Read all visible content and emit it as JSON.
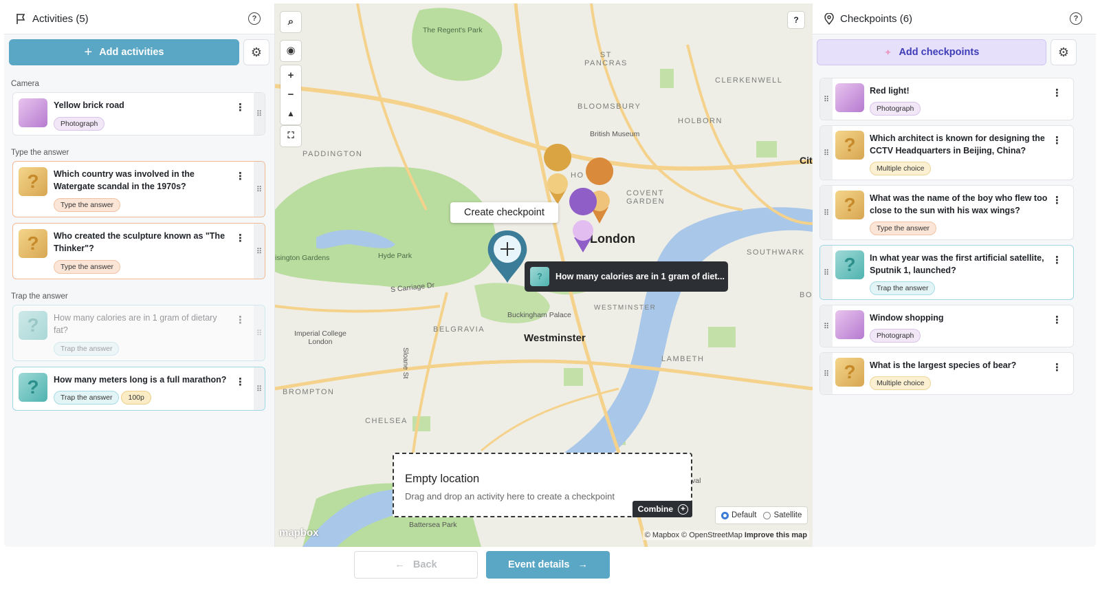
{
  "left_panel": {
    "title": "Activities (5)",
    "add_label": "Add activities",
    "sections": {
      "camera": "Camera",
      "type": "Type the answer",
      "trap": "Trap the answer"
    },
    "cards": [
      {
        "title": "Yellow brick road",
        "badges": [
          "Photograph"
        ]
      },
      {
        "title": "Which country was involved in the Watergate scandal in the 1970s?",
        "badges": [
          "Type the answer"
        ]
      },
      {
        "title": "Who created the sculpture known as \"The Thinker\"?",
        "badges": [
          "Type the answer"
        ]
      },
      {
        "title": "How many calories are in 1 gram of dietary fat?",
        "badges": [
          "Trap the answer"
        ]
      },
      {
        "title": "How many meters long is a full marathon?",
        "badges": [
          "Trap the answer",
          "100p"
        ]
      }
    ]
  },
  "map": {
    "create_tooltip": "Create checkpoint",
    "hover_tooltip": "How many calories are in 1 gram of diet...",
    "labels": {
      "regents_park": "The Regent's Park",
      "st_pancras": "ST\nPANCRAS",
      "clerkenwell": "CLERKENWELL",
      "bloomsbury": "BLOOMSBURY",
      "holborn": "HOLBORN",
      "british_museum": "British Museum",
      "paddington": "PADDINGTON",
      "city": "Cit",
      "covent_garden": "COVENT\nGARDEN",
      "soho": "HO",
      "london": "London",
      "southwark": "SOUTHWARK",
      "hyde_park": "Hyde Park",
      "kensington_gardens": "isington Gardens",
      "s_carriage": "S Carriage Dr",
      "westminster_upper": "WESTMINSTER",
      "bor": "BOR",
      "buckingham": "Buckingham Palace",
      "belgravia": "BELGRAVIA",
      "imperial": "Imperial College\nLondon",
      "westminster": "Westminster",
      "sloane": "Sloane St",
      "lambeth": "LAMBETH",
      "brompton": "BROMPTON",
      "chelsea": "CHELSEA",
      "battersea": "Battersea Park",
      "val": "val"
    },
    "empty_title": "Empty location",
    "empty_subtitle": "Drag and drop an activity here to create a checkpoint",
    "combine_label": "Combine",
    "style_default": "Default",
    "style_satellite": "Satellite",
    "attribution": "© Mapbox © OpenStreetMap",
    "improve": "Improve this map",
    "logo": "mapbox"
  },
  "right_panel": {
    "title": "Checkpoints (6)",
    "add_label": "Add checkpoints",
    "cards": [
      {
        "title": "Red light!",
        "badges": [
          "Photograph"
        ]
      },
      {
        "title": "Which architect is known for designing the CCTV Headquarters in Beijing, China?",
        "badges": [
          "Multiple choice"
        ]
      },
      {
        "title": "What was the name of the boy who flew too close to the sun with his wax wings?",
        "badges": [
          "Type the answer"
        ]
      },
      {
        "title": "In what year was the first artificial satellite, Sputnik 1, launched?",
        "badges": [
          "Trap the answer"
        ]
      },
      {
        "title": "Window shopping",
        "badges": [
          "Photograph"
        ]
      },
      {
        "title": "What is the largest species of bear?",
        "badges": [
          "Multiple choice"
        ]
      }
    ]
  },
  "footer": {
    "back_label": "Back",
    "next_label": "Event details"
  },
  "colors": {
    "accent": "#5aa6c5",
    "checkpoint_accent": "#e6e0fb",
    "water": "#a9c7e8",
    "park": "#b9dc9f",
    "road": "#f5d28b"
  }
}
